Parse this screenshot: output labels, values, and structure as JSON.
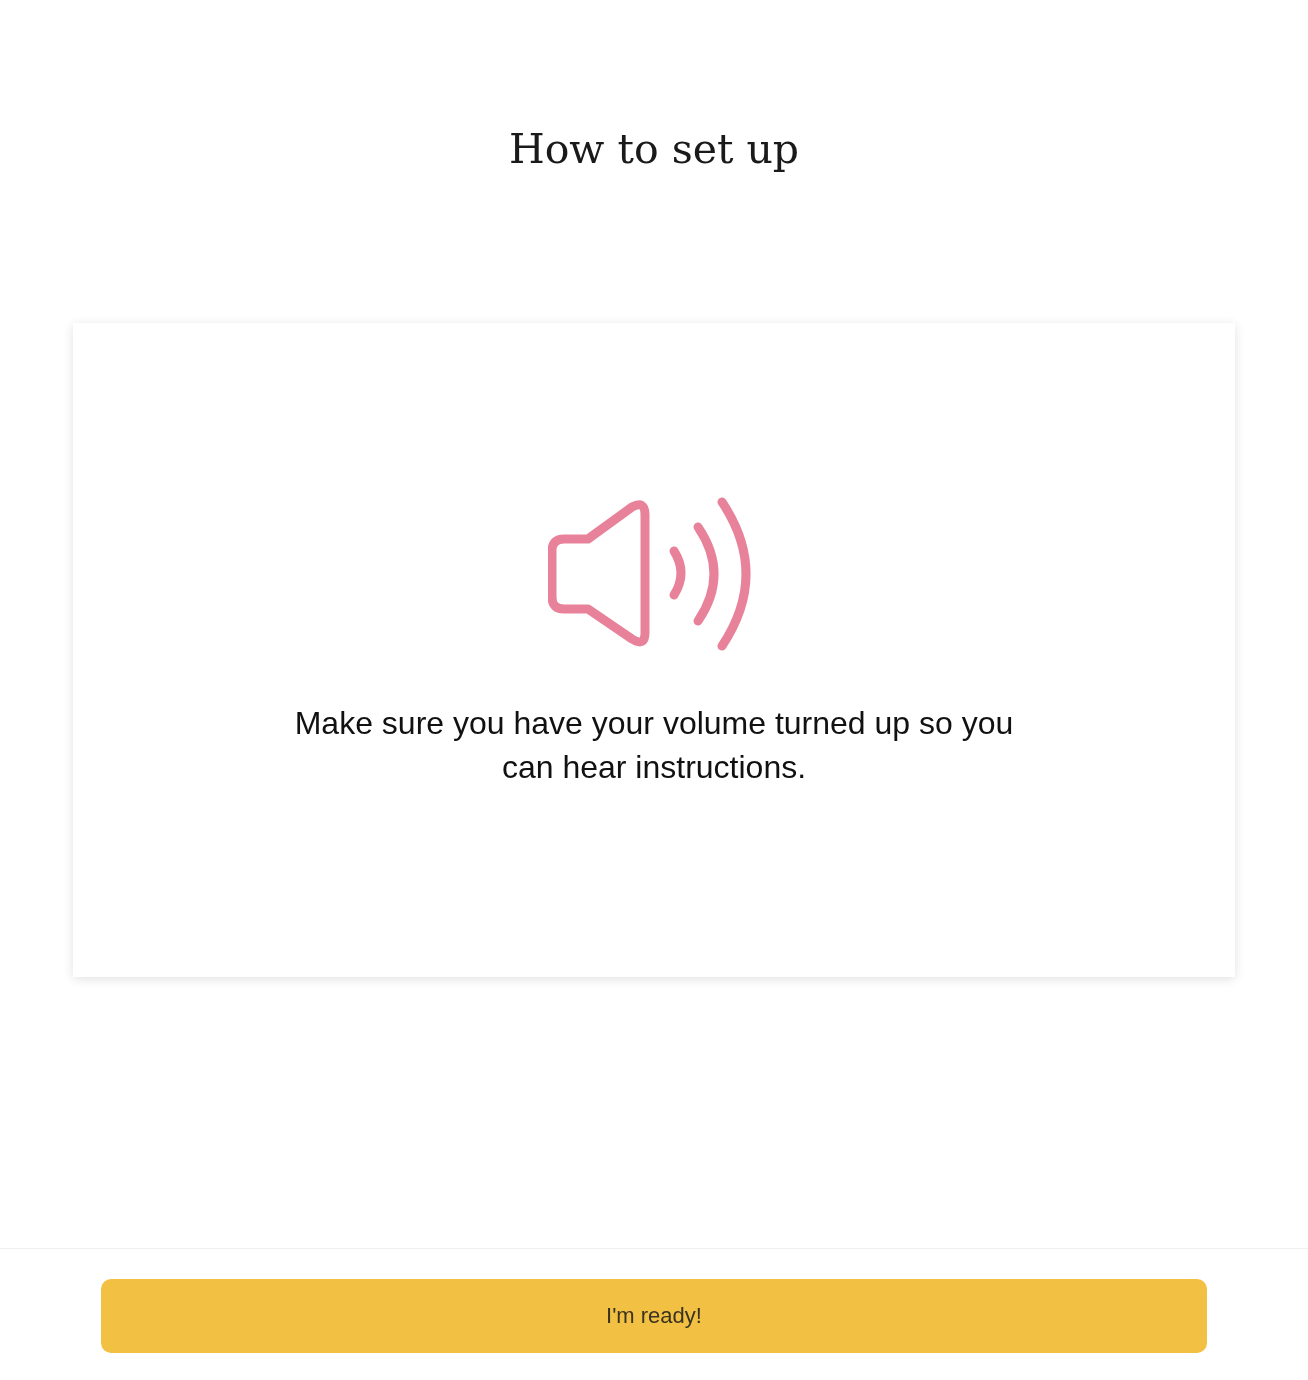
{
  "title": "How to set up",
  "card": {
    "message": "Make sure you have your volume turned up so you can hear instructions."
  },
  "footer": {
    "button": "I'm ready!"
  }
}
